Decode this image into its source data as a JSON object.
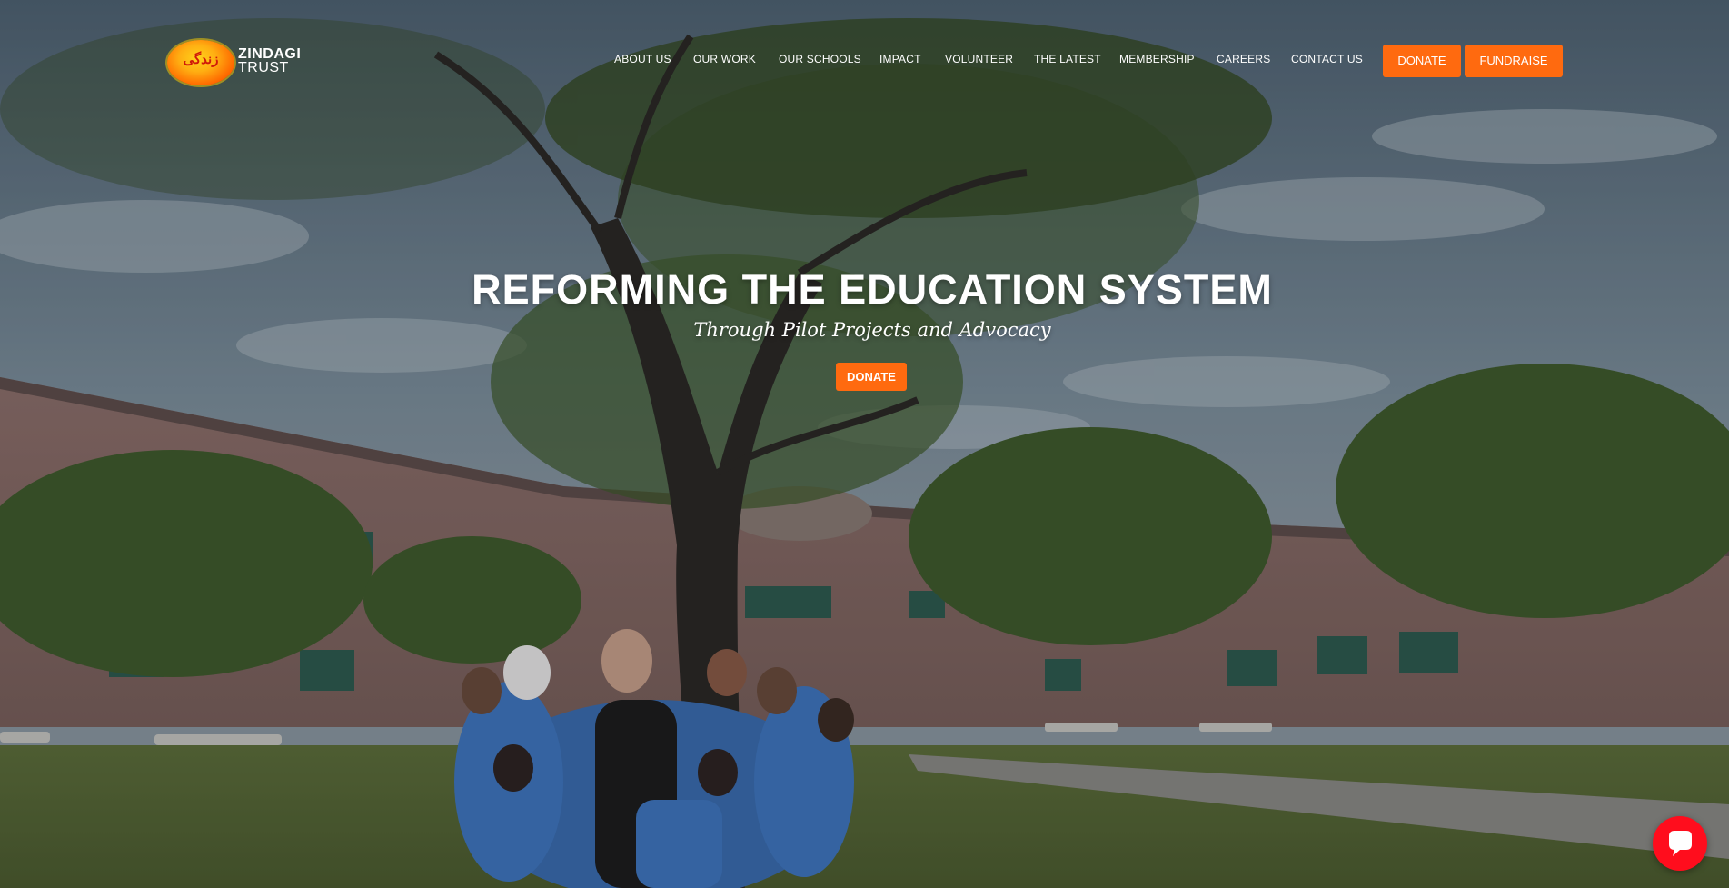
{
  "brand": {
    "logo_glyph": "زندگی",
    "name_line1": "ZINDAGI",
    "name_line2": "TRUST",
    "accent_color": "#ff6a0f"
  },
  "nav": {
    "items": [
      {
        "label": "ABOUT US"
      },
      {
        "label": "OUR WORK"
      },
      {
        "label": "OUR SCHOOLS"
      },
      {
        "label": "IMPACT"
      },
      {
        "label": "VOLUNTEER"
      },
      {
        "label": "THE LATEST"
      },
      {
        "label": "MEMBERSHIP"
      },
      {
        "label": "CAREERS"
      },
      {
        "label": "CONTACT US"
      }
    ],
    "donate_label": "DONATE",
    "fundraise_label": "FUNDRAISE"
  },
  "hero": {
    "headline": "REFORMING THE EDUCATION SYSTEM",
    "subheadline": "Through Pilot Projects and Advocacy",
    "cta_label": "DONATE"
  },
  "chat": {
    "icon": "chat-bubble-icon",
    "color": "#ff0d1d"
  }
}
